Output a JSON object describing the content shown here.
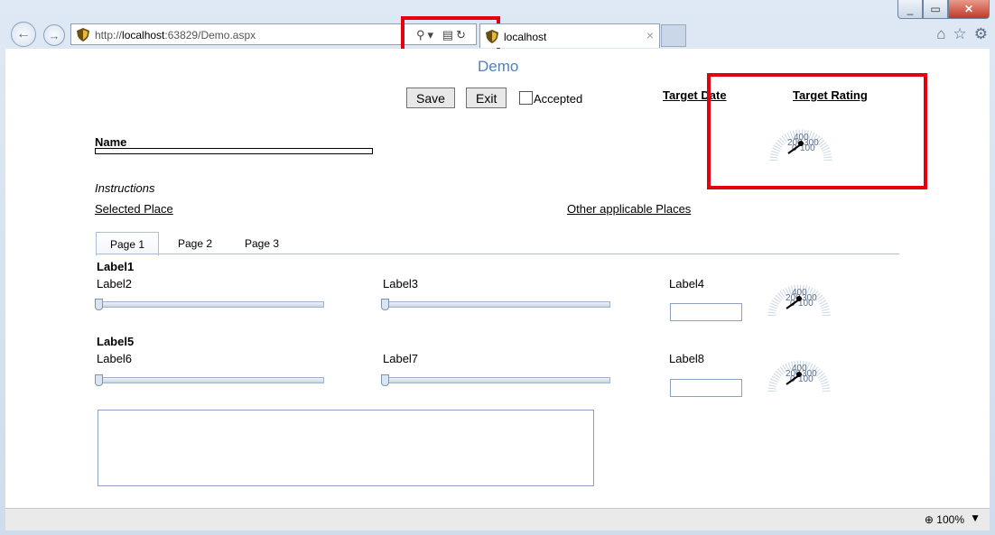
{
  "browser": {
    "address": {
      "url_prefix": "http://",
      "url_host": "localhost",
      "url_rest": ":63829/Demo.aspx"
    },
    "tab_title": "localhost",
    "tab_close": "×",
    "zoom": "100%",
    "zoom_caret": "▼"
  },
  "page": {
    "title": "Demo",
    "save_label": "Save",
    "exit_label": "Exit",
    "accepted_label": "Accepted",
    "target_date": "Target Date",
    "target_rating": "Target Rating",
    "name_label": "Name",
    "instructions": "Instructions",
    "selected_place": "Selected Place",
    "other_places": "Other applicable Places",
    "tabs": [
      "Page 1",
      "Page 2",
      "Page 3"
    ],
    "groups": [
      {
        "title": "Label1",
        "a": "Label2",
        "b": "Label3",
        "c": "Label4"
      },
      {
        "title": "Label5",
        "a": "Label6",
        "b": "Label7",
        "c": "Label8"
      }
    ],
    "gauge_labels": [
      "400",
      "200",
      "300",
      "0",
      "100"
    ]
  },
  "colors": {
    "highlight": "#e3000f",
    "title": "#4f81bd"
  }
}
